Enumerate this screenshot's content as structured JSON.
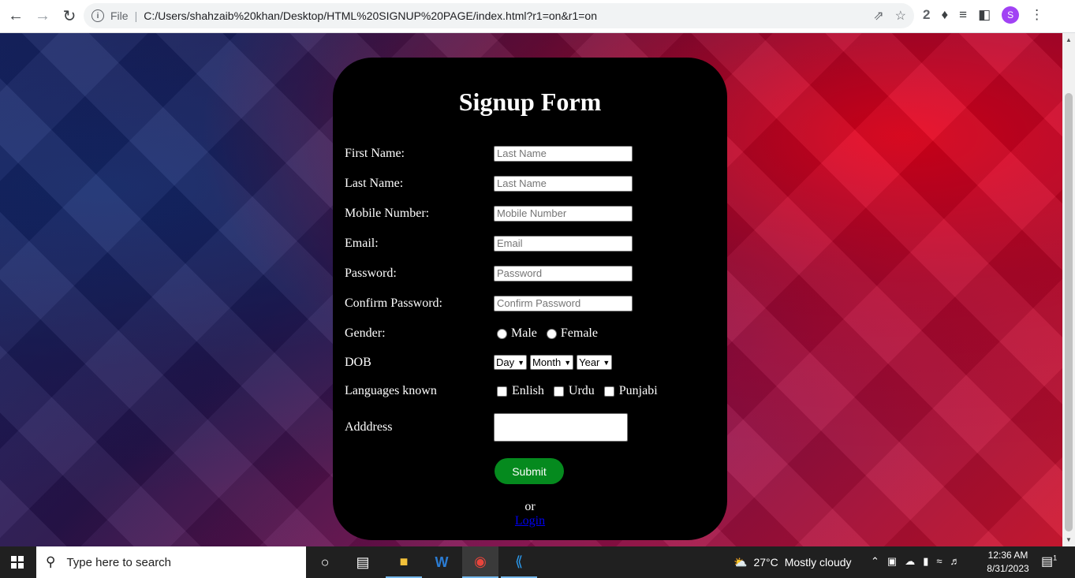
{
  "browser": {
    "file_label": "File",
    "url": "C:/Users/shahzaib%20khan/Desktop/HTML%20SIGNUP%20PAGE/index.html?r1=on&r1=on",
    "profile_initial": "S"
  },
  "form": {
    "title": "Signup Form",
    "fields": [
      {
        "label": "First Name:",
        "placeholder": "Last Name"
      },
      {
        "label": "Last Name:",
        "placeholder": "Last Name"
      },
      {
        "label": "Mobile Number:",
        "placeholder": "Mobile Number"
      },
      {
        "label": "Email:",
        "placeholder": "Email"
      },
      {
        "label": "Password:",
        "placeholder": "Password"
      },
      {
        "label": "Confirm Password:",
        "placeholder": "Confirm Password"
      }
    ],
    "gender": {
      "label": "Gender:",
      "options": [
        "Male",
        "Female"
      ]
    },
    "dob": {
      "label": "DOB",
      "selects": [
        "Day",
        "Month",
        "Year"
      ]
    },
    "languages": {
      "label": "Languages known",
      "options": [
        "Enlish",
        "Urdu",
        "Punjabi"
      ]
    },
    "address": {
      "label": "Adddress"
    },
    "submit_label": "Submit",
    "or_text": "or",
    "login_link": "Login"
  },
  "taskbar": {
    "search_placeholder": "Type here to search",
    "weather_temp": "27°C",
    "weather_desc": "Mostly cloudy",
    "time": "12:36 AM",
    "date": "8/31/2023",
    "notification_count": "1"
  }
}
